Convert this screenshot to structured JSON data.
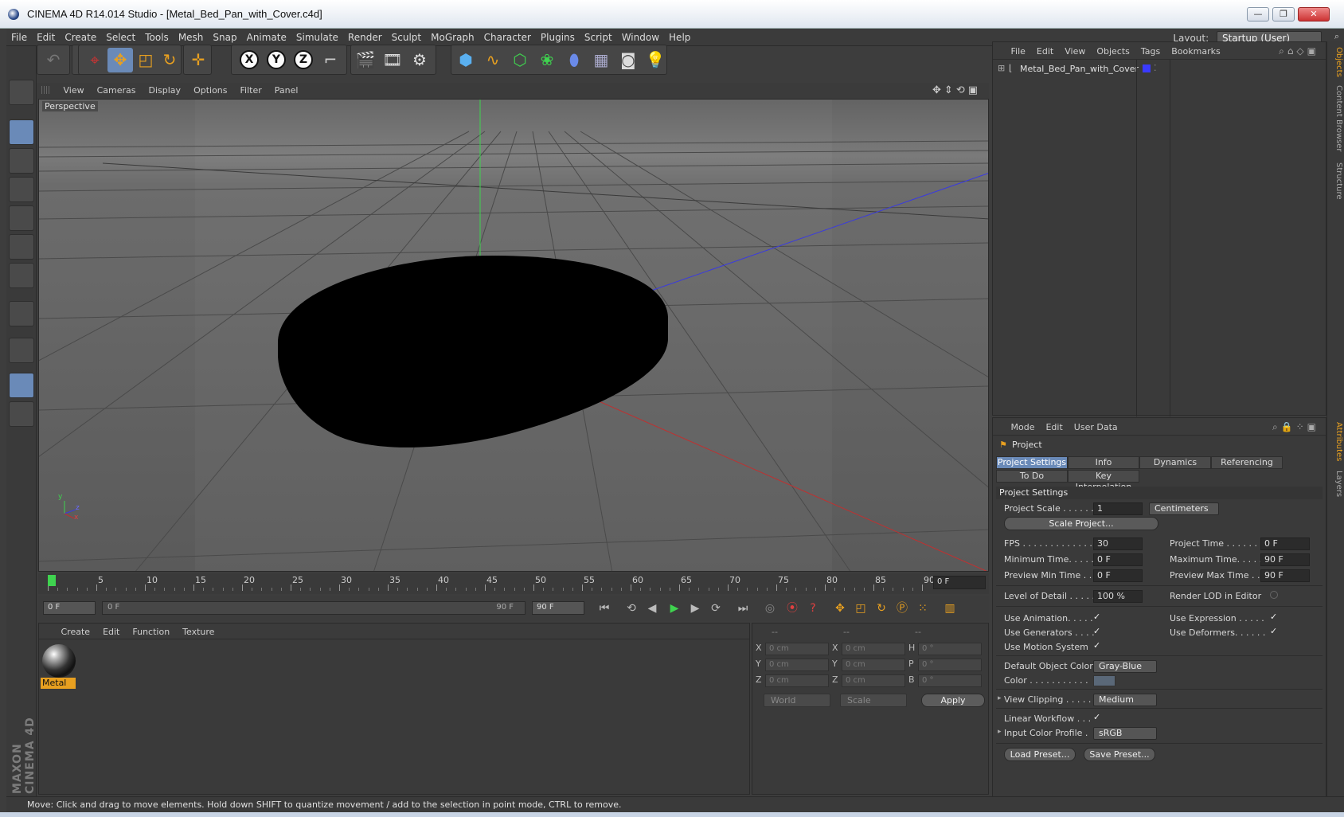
{
  "window": {
    "title": "CINEMA 4D R14.014 Studio - [Metal_Bed_Pan_with_Cover.c4d]",
    "min": "—",
    "max": "❐",
    "close": "✕"
  },
  "menubar": {
    "items": [
      "File",
      "Edit",
      "Create",
      "Select",
      "Tools",
      "Mesh",
      "Snap",
      "Animate",
      "Simulate",
      "Render",
      "Sculpt",
      "MoGraph",
      "Character",
      "Plugins",
      "Script",
      "Window",
      "Help"
    ],
    "layout_label": "Layout:",
    "layout_value": "Startup (User)"
  },
  "viewport": {
    "menu": [
      "View",
      "Cameras",
      "Display",
      "Options",
      "Filter",
      "Panel"
    ],
    "label": "Perspective",
    "axis_y": "y",
    "axis_z": "z",
    "axis_x": "x"
  },
  "timeline": {
    "labels": [
      "0",
      "5",
      "10",
      "15",
      "20",
      "25",
      "30",
      "35",
      "40",
      "45",
      "50",
      "55",
      "60",
      "65",
      "70",
      "75",
      "80",
      "85",
      "90"
    ],
    "current_frame": "0 F",
    "start": "0 F",
    "slider_start": "0 F",
    "slider_end": "90 F",
    "end": "90 F"
  },
  "materials": {
    "menu": [
      "Create",
      "Edit",
      "Function",
      "Texture"
    ],
    "items": [
      {
        "name": "Metal"
      }
    ]
  },
  "coords": {
    "headers": [
      "--",
      "--",
      "--"
    ],
    "rows": [
      {
        "a": "X",
        "av": "0 cm",
        "b": "X",
        "bv": "0 cm",
        "c": "H",
        "cv": "0 °"
      },
      {
        "a": "Y",
        "av": "0 cm",
        "b": "Y",
        "bv": "0 cm",
        "c": "P",
        "cv": "0 °"
      },
      {
        "a": "Z",
        "av": "0 cm",
        "b": "Z",
        "bv": "0 cm",
        "c": "B",
        "cv": "0 °"
      }
    ],
    "space": "World",
    "mode": "Scale",
    "apply": "Apply"
  },
  "objects": {
    "menu": [
      "File",
      "Edit",
      "View",
      "Objects",
      "Tags",
      "Bookmarks"
    ],
    "items": [
      {
        "name": "Metal_Bed_Pan_with_Cover",
        "color": "#3a3aff"
      }
    ]
  },
  "attributes": {
    "menu": [
      "Mode",
      "Edit",
      "User Data"
    ],
    "header": "Project",
    "tabs_row1": [
      "Project Settings",
      "Info",
      "Dynamics",
      "Referencing"
    ],
    "tabs_row2": [
      "To Do",
      "Key Interpolation"
    ],
    "section": "Project Settings",
    "project_scale_label": "Project Scale . . . . . .",
    "project_scale_value": "1",
    "project_scale_unit": "Centimeters",
    "scale_project_btn": "Scale Project...",
    "fps_label": "FPS . . . . . . . . . . . . . .",
    "fps_value": "30",
    "project_time_label": "Project Time . . . . . . . .",
    "project_time_value": "0 F",
    "min_time_label": "Minimum Time. . . . . .",
    "min_time_value": "0 F",
    "max_time_label": "Maximum Time. . . . . .",
    "max_time_value": "90 F",
    "prev_min_label": "Preview Min Time . . .",
    "prev_min_value": "0 F",
    "prev_max_label": "Preview Max Time . . .",
    "prev_max_value": "90 F",
    "lod_label": "Level of Detail . . . . . .",
    "lod_value": "100 %",
    "render_lod_label": "Render LOD in Editor",
    "use_anim_label": "Use Animation. . . . .",
    "use_expr_label": "Use Expression . . . . .",
    "use_gen_label": "Use Generators . . . .",
    "use_def_label": "Use Deformers. . . . . .",
    "use_motion_label": "Use Motion System",
    "check": "✓",
    "def_obj_color_label": "Default Object Color",
    "def_obj_color_value": "Gray-Blue",
    "color_label": "Color . . . . . . . . . . .",
    "view_clip_label": "View Clipping . . . . .",
    "view_clip_value": "Medium",
    "linear_label": "Linear Workflow . . .",
    "input_profile_label": "Input Color Profile .",
    "input_profile_value": "sRGB",
    "load_preset": "Load Preset...",
    "save_preset": "Save Preset..."
  },
  "right_tabs": [
    "Objects",
    "Content Browser",
    "Structure",
    "Attributes",
    "Layers"
  ],
  "brand": "MAXON CINEMA 4D",
  "status": "Move: Click and drag to move elements. Hold down SHIFT to quantize movement / add to the selection in point mode, CTRL to remove."
}
